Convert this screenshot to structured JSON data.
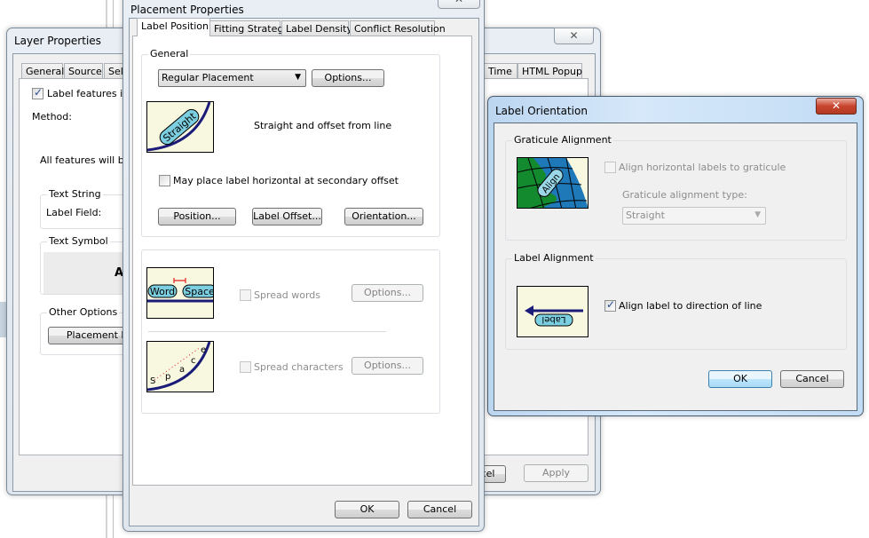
{
  "layer_properties": {
    "title": "Layer Properties",
    "tabs": [
      "General",
      "Source",
      "Sel",
      "Time",
      "HTML Popup"
    ],
    "label_features_checkbox": "Label features in th",
    "label_features_checked": true,
    "method_label": "Method:",
    "all_features_text": "All features will be la",
    "text_string_group": "Text String",
    "label_field_label": "Label Field:",
    "text_symbol_group": "Text Symbol",
    "symbol_preview": "A",
    "other_options_group": "Other Options",
    "placement_button": "Placement P",
    "cancel_button": "cel",
    "apply_button": "Apply"
  },
  "placement_properties": {
    "title": "Placement Properties",
    "tabs": [
      "Label Position",
      "Fitting Strategy",
      "Label Density",
      "Conflict Resolution"
    ],
    "active_tab": "Label Position",
    "general_group": "General",
    "placement_select": "Regular Placement",
    "options_button": "Options...",
    "preview_label": "Straight",
    "description": "Straight and offset from line",
    "secondary_offset_checkbox": "May place label horizontal at secondary offset",
    "secondary_offset_checked": false,
    "position_button": "Position...",
    "label_offset_button": "Label Offset...",
    "orientation_button": "Orientation...",
    "spread_words_checkbox": "Spread words",
    "spread_words_checked": false,
    "spread_words_options": "Options...",
    "word_pic_labels": [
      "Word",
      "Space"
    ],
    "spread_chars_checkbox": "Spread characters",
    "spread_chars_checked": false,
    "spread_chars_options": "Options...",
    "char_pic_letters": [
      "S",
      "p",
      "a",
      "c",
      "e"
    ],
    "ok_button": "OK",
    "cancel_button": "Cancel"
  },
  "label_orientation": {
    "title": "Label Orientation",
    "graticule_group": "Graticule Alignment",
    "graticule_pic_label": "Align",
    "align_graticule_checkbox": "Align horizontal labels to graticule",
    "align_graticule_checked": false,
    "alignment_type_label": "Graticule alignment type:",
    "alignment_type_value": "Straight",
    "label_alignment_group": "Label Alignment",
    "label_pic_label": "Label",
    "align_direction_checkbox": "Align label to direction of line",
    "align_direction_checked": true,
    "ok_button": "OK",
    "cancel_button": "Cancel"
  },
  "colors": {
    "line": "#1b1b7a",
    "label_fill": "#7ccfe0",
    "pic_bg": "#f8f8e0",
    "land": "#148a2e",
    "water": "#1f78b8"
  }
}
